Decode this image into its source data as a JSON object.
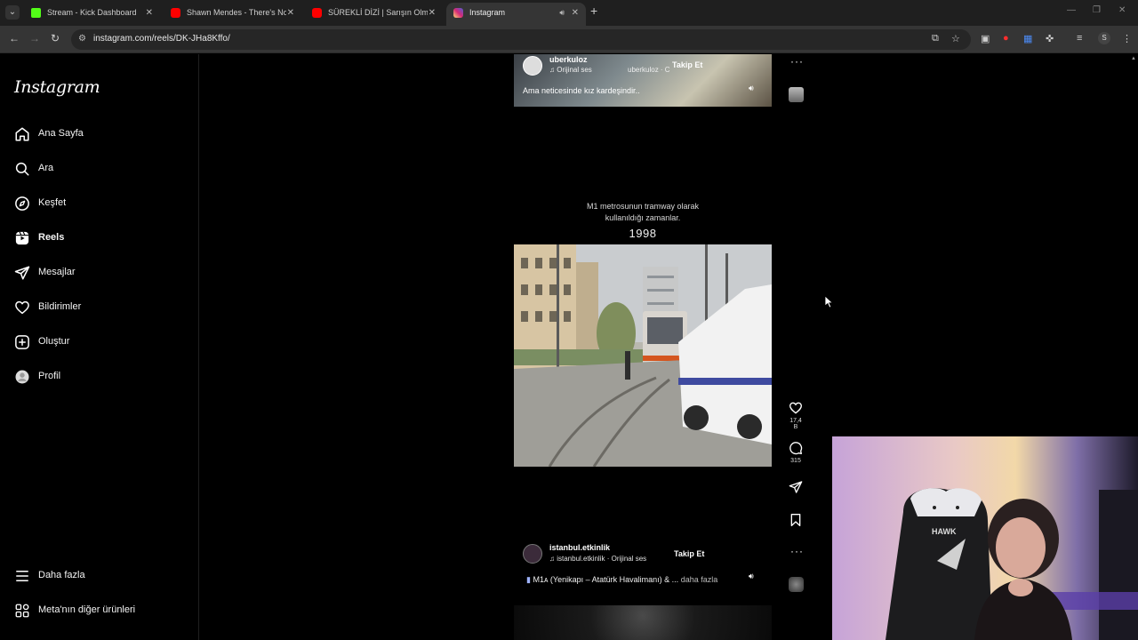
{
  "browser": {
    "tabs": [
      {
        "title": "Stream - Kick Dashboard",
        "favicon": "kick-icon",
        "color": "#53fc18",
        "active": false
      },
      {
        "title": "Shawn Mendes - There's Nothin",
        "favicon": "youtube-icon",
        "color": "#ff0000",
        "active": false
      },
      {
        "title": "SÜREKLİ DİZİ | Sarışın Olma İdd",
        "favicon": "youtube-icon",
        "color": "#ff0000",
        "active": false
      },
      {
        "title": "Instagram",
        "favicon": "instagram-icon",
        "color": "#d6249f",
        "active": true
      }
    ],
    "url": "instagram.com/reels/DK-JHa8Kffo/",
    "profile_initial": "S"
  },
  "sidebar": {
    "logo": "Instagram",
    "items": [
      {
        "label": "Ana Sayfa",
        "icon": "home-icon"
      },
      {
        "label": "Ara",
        "icon": "search-icon"
      },
      {
        "label": "Keşfet",
        "icon": "compass-icon"
      },
      {
        "label": "Reels",
        "icon": "reels-icon",
        "active": true
      },
      {
        "label": "Mesajlar",
        "icon": "send-icon"
      },
      {
        "label": "Bildirimler",
        "icon": "heart-icon"
      },
      {
        "label": "Oluştur",
        "icon": "plus-square-icon"
      },
      {
        "label": "Profil",
        "icon": "avatar-icon"
      }
    ],
    "more": "Daha fazla",
    "meta": "Meta'nın diğer ürünleri"
  },
  "reel_previous": {
    "username": "uberkuloz",
    "audio": "Orijinal ses",
    "overlay_user": "uberkuloz · C",
    "follow": "Takip Et",
    "caption": "Ama neticesinde kız kardeşindir.."
  },
  "reel_current": {
    "overlay_caption_line1": "M1 metrosunun tramway olarak",
    "overlay_caption_line2": "kullanıldığı zamanlar.",
    "overlay_year": "1998",
    "username": "istanbul.etkinlik",
    "audio": "istanbul.etkinlik · Orijinal ses",
    "follow": "Takip Et",
    "caption": "M1ᴀ (Yenikapı – Atatürk Havalimanı) & ...",
    "caption_more": "daha fazla",
    "likes": "17,4 B",
    "comments": "315"
  }
}
